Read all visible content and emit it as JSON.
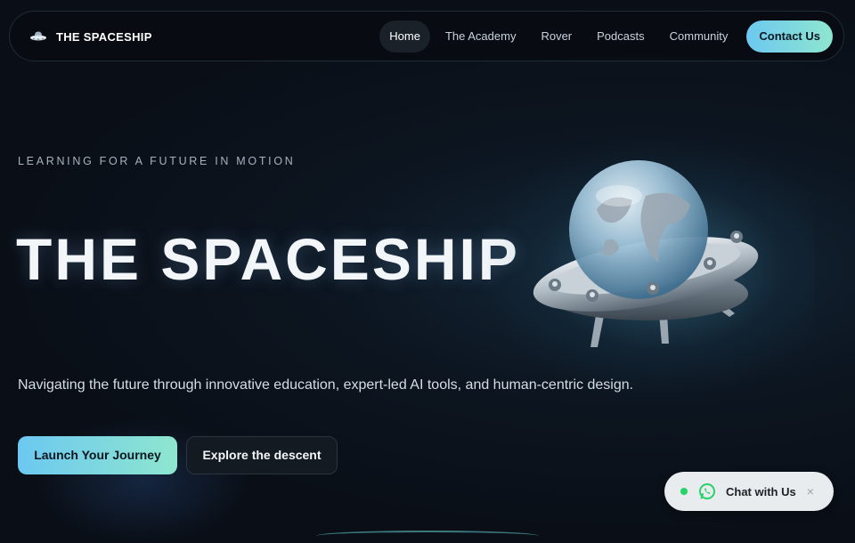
{
  "nav": {
    "brand": "THE SPACESHIP",
    "brand_icon": "ufo-icon",
    "links": [
      {
        "label": "Home",
        "active": true
      },
      {
        "label": "The Academy",
        "active": false
      },
      {
        "label": "Rover",
        "active": false
      },
      {
        "label": "Podcasts",
        "active": false
      },
      {
        "label": "Community",
        "active": false
      }
    ],
    "contact_label": "Contact Us"
  },
  "hero": {
    "tagline": "LEARNING FOR A FUTURE IN MOTION",
    "title": "THE SPACESHIP",
    "description": "Navigating the future through innovative education, expert-led AI tools, and human-centric design.",
    "primary_button": "Launch Your Journey",
    "secondary_button": "Explore the descent",
    "illustration": "ufo-with-globe-dome"
  },
  "chat": {
    "label": "Chat with Us",
    "icon": "whatsapp-icon",
    "close": "×",
    "status": "online"
  },
  "colors": {
    "background": "#0a0f17",
    "accent_start": "#6cc8f0",
    "accent_end": "#8ee6cf",
    "online_green": "#25d366"
  }
}
